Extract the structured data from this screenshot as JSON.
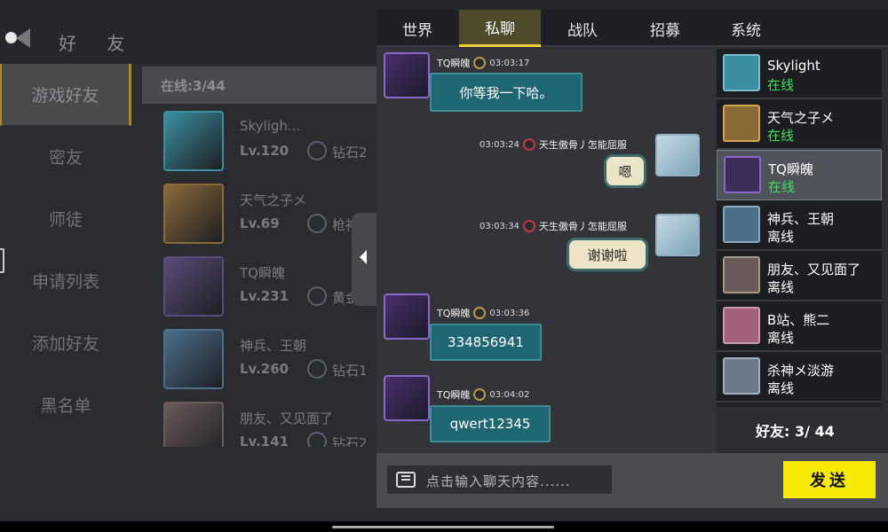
{
  "background_page": {
    "title": "好 友",
    "menu": [
      "游戏好友",
      "密友",
      "师徒",
      "申请列表",
      "添加好友",
      "黑名单"
    ],
    "online_label": "在线:3/44",
    "friends": [
      {
        "name": "Skyligh...",
        "level": "Lv.120",
        "rank": "钻石2",
        "avatar_color": "#3b8fa0"
      },
      {
        "name": "天气之子メ",
        "level": "Lv.69",
        "rank": "枪神",
        "avatar_color": "#8b6a3a"
      },
      {
        "name": "TQ瞬魄",
        "level": "Lv.231",
        "rank": "黄金",
        "avatar_color": "#5a4b7a"
      },
      {
        "name": "神兵、王朝",
        "level": "Lv.260",
        "rank": "钻石1",
        "avatar_color": "#4c6f8c"
      },
      {
        "name": "朋友、又见面了",
        "level": "Lv.141",
        "rank": "钻石2",
        "avatar_color": "#6b5a5a"
      }
    ]
  },
  "chat": {
    "tabs": [
      "世界",
      "私聊",
      "战队",
      "招募",
      "系统"
    ],
    "active_tab": "私聊",
    "messages": [
      {
        "side": "left",
        "sender": "TQ瞬魄",
        "time": "03:03:17",
        "text": "你等我一下哈。"
      },
      {
        "side": "right",
        "sender": "天生傲骨丿怎能屈服",
        "time": "03:03:24",
        "text": "嗯"
      },
      {
        "side": "right",
        "sender": "天生傲骨丿怎能屈服",
        "time": "03:03:34",
        "text": "谢谢啦"
      },
      {
        "side": "left",
        "sender": "TQ瞬魄",
        "time": "03:03:36",
        "text": "334856941"
      },
      {
        "side": "left",
        "sender": "TQ瞬魄",
        "time": "03:04:02",
        "text": "qwert12345"
      }
    ],
    "contacts": [
      {
        "name": "Skylight",
        "status": "在线",
        "online": true,
        "avatar_color": "#3b8fa0"
      },
      {
        "name": "天气之子メ",
        "status": "在线",
        "online": true,
        "avatar_color": "#8b6a3a"
      },
      {
        "name": "TQ瞬魄",
        "status": "在线",
        "online": true,
        "avatar_color": "#5a4b7a"
      },
      {
        "name": "神兵、王朝",
        "status": "离线",
        "online": false,
        "avatar_color": "#4c6f8c"
      },
      {
        "name": "朋友、又见面了",
        "status": "离线",
        "online": false,
        "avatar_color": "#6b5a5a"
      },
      {
        "name": "B站、熊二",
        "status": "离线",
        "online": false,
        "avatar_color": "#a0607a"
      },
      {
        "name": "杀神メ淡游",
        "status": "离线",
        "online": false,
        "avatar_color": "#6b7b8a"
      }
    ],
    "friend_count": "好友: 3/ 44",
    "input_placeholder": "点击输入聊天内容......",
    "send_label": "发送"
  },
  "colors": {
    "accent_yellow": "#f7ea04",
    "online_green": "#3fe05d",
    "bubble_teal": "#1f6673"
  }
}
